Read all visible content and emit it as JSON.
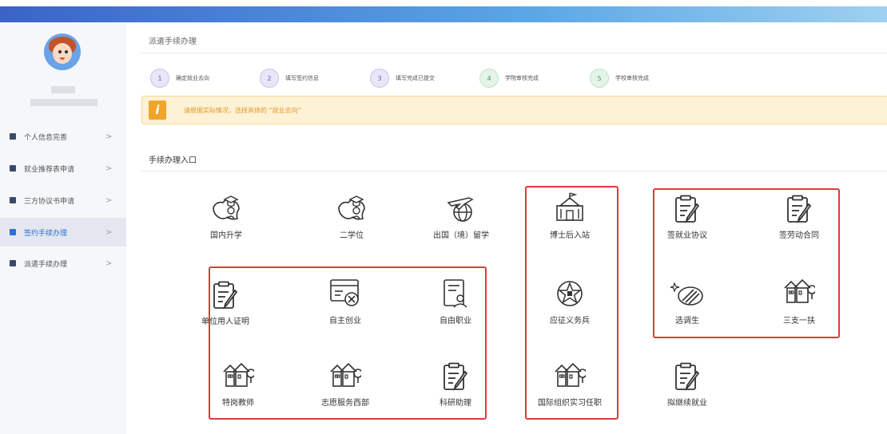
{
  "sidebar": {
    "items": [
      {
        "label": "个人信息完善",
        "icon": "user-icon"
      },
      {
        "label": "就业推荐表申请",
        "icon": "form-icon"
      },
      {
        "label": "三方协议书申请",
        "icon": "agreement-icon"
      },
      {
        "label": "签约手续办理",
        "icon": "sign-icon",
        "active": true
      },
      {
        "label": "派遣手续办理",
        "icon": "dispatch-icon"
      }
    ],
    "chevron": ">"
  },
  "page_title": "派遣手续办理",
  "steps": [
    {
      "num": "1",
      "label": "确定就业去向"
    },
    {
      "num": "2",
      "label": "填写签约信息"
    },
    {
      "num": "3",
      "label": "填写完成已提交"
    },
    {
      "num": "4",
      "label": "学院审核完成"
    },
    {
      "num": "5",
      "label": "学校审核完成"
    }
  ],
  "alert": {
    "icon": "i",
    "text": "请根据实际情况，选择具体的 “就业去向”"
  },
  "section_title": "手续办理入口",
  "cards": {
    "domestic": "国内升学",
    "second_degree": "二学位",
    "abroad": "出国（境）留学",
    "postdoc": "博士后入站",
    "sign_employment": "签就业协议",
    "sign_labor": "签劳动合同",
    "employer_cert": "单位用人证明",
    "self_startup": "自主创业",
    "freelance": "自由职业",
    "conscription": "应征义务兵",
    "selected_grad": "选调生",
    "three_support": "三支一扶",
    "special_teacher": "特岗教师",
    "volunteer_west": "志愿服务西部",
    "research_assistant": "科研助理",
    "intl_org": "国际组织实习任职",
    "continue_job": "拟继续就业"
  },
  "colors": {
    "accent": "#2f6fd6",
    "highlight_box": "#e03a3a",
    "alert_bg": "#fdf1d6",
    "alert_icon": "#f0a42c"
  }
}
